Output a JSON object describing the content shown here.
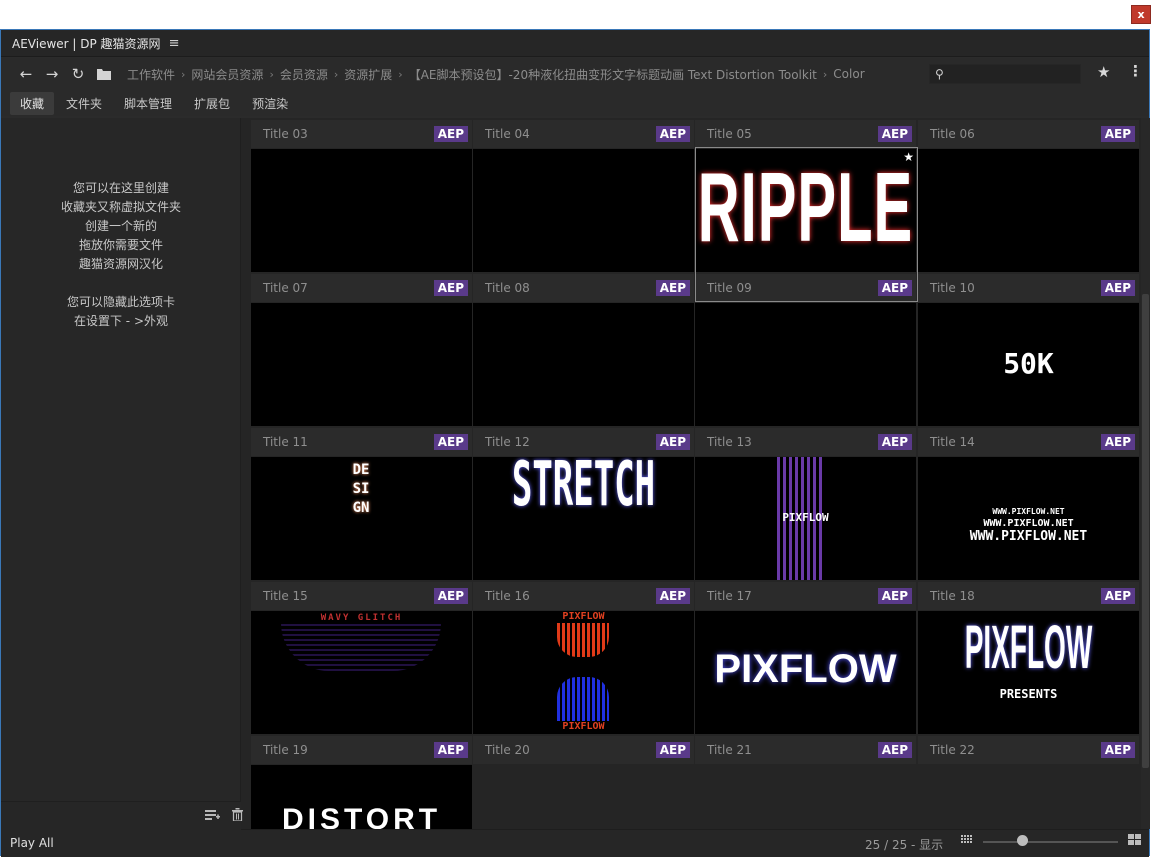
{
  "window": {
    "close_label": "x"
  },
  "titlebar": {
    "title": "AEViewer | DP 趣猫资源网",
    "menu_icon": "≡"
  },
  "nav": {
    "breadcrumb": [
      "工作软件",
      "网站会员资源",
      "会员资源",
      "资源扩展",
      "【AE脚本预设包】-20种液化扭曲变形文字标题动画 Text Distortion Toolkit",
      "Color"
    ],
    "search": {
      "value": "",
      "placeholder": ""
    }
  },
  "tabs": [
    {
      "label": "收藏",
      "active": true
    },
    {
      "label": "文件夹"
    },
    {
      "label": "脚本管理"
    },
    {
      "label": "扩展包"
    },
    {
      "label": "预渲染"
    }
  ],
  "sidebar": {
    "lines": [
      "您可以在这里创建",
      "收藏夹又称虚拟文件夹",
      "创建一个新的",
      "拖放你需要文件",
      "趣猫资源网汉化"
    ],
    "lines2": [
      "您可以隐藏此选项卡",
      "在设置下 - >外观"
    ]
  },
  "grid": {
    "badge": "AEP",
    "items": [
      {
        "title": "Title 03"
      },
      {
        "title": "Title 04"
      },
      {
        "title": "Title 05"
      },
      {
        "title": "Title 06"
      },
      {
        "title": "Title 07"
      },
      {
        "title": "Title 08"
      },
      {
        "title": "Title 09",
        "selected": true
      },
      {
        "title": "Title 10"
      },
      {
        "title": "Title 11"
      },
      {
        "title": "Title 12"
      },
      {
        "title": "Title 13"
      },
      {
        "title": "Title 14"
      },
      {
        "title": "Title 15"
      },
      {
        "title": "Title 16"
      },
      {
        "title": "Title 17"
      },
      {
        "title": "Title 18"
      },
      {
        "title": "Title 19"
      },
      {
        "title": "Title 20"
      },
      {
        "title": "Title 21"
      },
      {
        "title": "Title 22"
      }
    ],
    "thumb_texts": {
      "ripple": "RIPPLE",
      "fifty_k": "50K",
      "design": "DESIGN",
      "stretch": "STRETCH",
      "pixflow_small": "PIXFLOW",
      "www1": "WWW.PIXFLOW.NET",
      "www2": "WWW.PIXFLOW.NET",
      "www3": "WWW.PIXFLOW.NET",
      "wavy": "WAVY GLITCH",
      "pf_top": "PIXFLOW",
      "pf_bottom": "PIXFLOW",
      "pixflow_big": "PIXFLOW",
      "pixflow_tall": "PIXFLOW",
      "presents": "PRESENTS",
      "distort": "DISTORT"
    }
  },
  "status": {
    "play_all": "Play All",
    "count": "25 / 25 - 显示"
  }
}
